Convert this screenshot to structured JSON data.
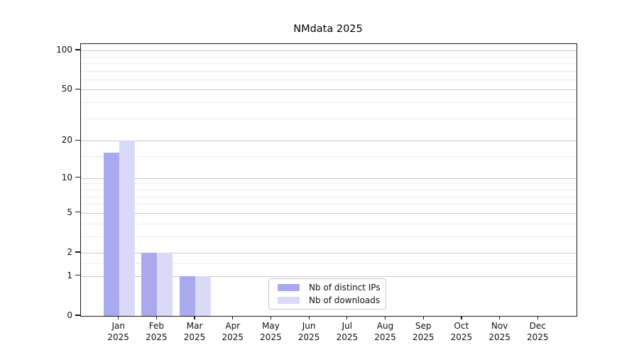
{
  "chart_data": {
    "type": "bar",
    "title": "NMdata 2025",
    "x": {
      "months": [
        "Jan",
        "Feb",
        "Mar",
        "Apr",
        "May",
        "Jun",
        "Jul",
        "Aug",
        "Sep",
        "Oct",
        "Nov",
        "Dec"
      ],
      "year": "2025"
    },
    "series": [
      {
        "name": "Nb of distinct IPs",
        "color": "#a9a9f0",
        "values": [
          16,
          2,
          1,
          0,
          0,
          0,
          0,
          0,
          0,
          0,
          0,
          0
        ]
      },
      {
        "name": "Nb of downloads",
        "color": "#dadaf8",
        "values": [
          20,
          2,
          1,
          0,
          0,
          0,
          0,
          0,
          0,
          0,
          0,
          0
        ]
      }
    ],
    "yaxis": {
      "scale": "log10(value+1)",
      "major_ticks": [
        0,
        1,
        2,
        5,
        10,
        20,
        50,
        100
      ],
      "minor_ticks": [
        1.5,
        3,
        4,
        6,
        7,
        8,
        9,
        15,
        30,
        40,
        60,
        70,
        80,
        90
      ],
      "ylim": [
        0,
        112
      ]
    },
    "grid": {
      "major_color": "#c9c9c9",
      "minor_color": "#ededed"
    },
    "legend": {
      "position": "lower-center"
    },
    "frame_color": "#1a1a1a"
  }
}
